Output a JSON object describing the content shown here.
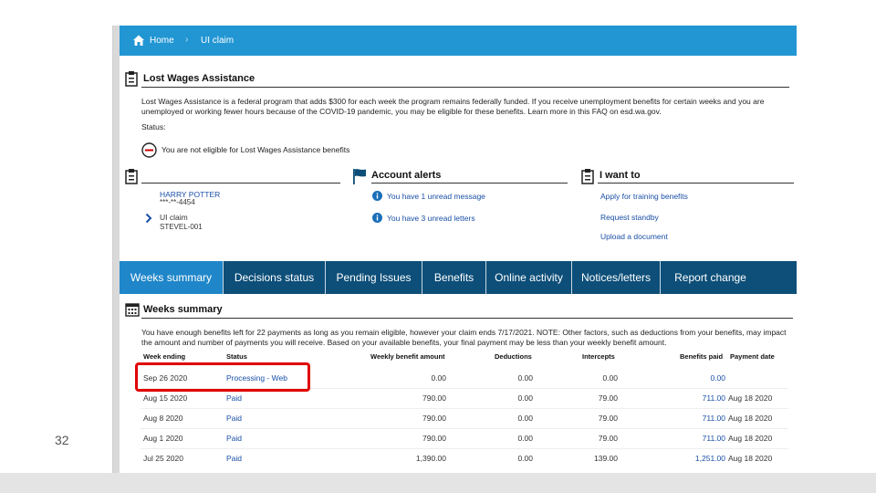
{
  "slide": {
    "number": "32"
  },
  "breadcrumb": {
    "home": "Home",
    "separator": "›",
    "current": "UI claim"
  },
  "lwa": {
    "title": "Lost Wages Assistance",
    "description": "Lost Wages Assistance is a federal program that adds $300 for each week the program remains federally funded. If you receive unemployment benefits for certain weeks and you are unemployed or working fewer hours because of the COVID-19 pandemic, you may be eligible for these benefits. Learn more in this FAQ on esd.wa.gov.",
    "status_label": "Status:",
    "status_text": "You are not eligible for Lost Wages Assistance benefits"
  },
  "profile": {
    "name": "HARRY POTTER",
    "ssn": "***-**-4454",
    "claim_label": "UI claim",
    "claim_id": "STEVEL-001"
  },
  "account_alerts": {
    "title": "Account alerts",
    "items": [
      "You have 1 unread message",
      "You have 3 unread letters"
    ]
  },
  "i_want_to": {
    "title": "I want to",
    "items": [
      "Apply for training benefits",
      "Request standby",
      "Upload a document"
    ]
  },
  "tabs": [
    "Weeks summary",
    "Decisions status",
    "Pending Issues",
    "Benefits",
    "Online activity",
    "Notices/letters",
    "Report change"
  ],
  "weeks_summary": {
    "title": "Weeks summary",
    "note": "You have enough benefits left for 22 payments as long as you remain eligible, however your claim ends 7/17/2021. NOTE: Other factors, such as deductions from your benefits, may impact the amount and number of payments you will receive. Based on your available benefits, your final payment may be less than your weekly benefit amount.",
    "columns": [
      "Week ending",
      "Status",
      "Weekly benefit amount",
      "Deductions",
      "Intercepts",
      "Benefits paid",
      "Payment date"
    ],
    "rows": [
      [
        "Sep 26 2020",
        "Processing - Web",
        "0.00",
        "0.00",
        "0.00",
        "0.00",
        ""
      ],
      [
        "Aug 15 2020",
        "Paid",
        "790.00",
        "0.00",
        "79.00",
        "711.00",
        "Aug 18 2020"
      ],
      [
        "Aug 8 2020",
        "Paid",
        "790.00",
        "0.00",
        "79.00",
        "711.00",
        "Aug 18 2020"
      ],
      [
        "Aug 1 2020",
        "Paid",
        "790.00",
        "0.00",
        "79.00",
        "711.00",
        "Aug 18 2020"
      ],
      [
        "Jul 25 2020",
        "Paid",
        "1,390.00",
        "0.00",
        "139.00",
        "1,251.00",
        "Aug 18 2020"
      ]
    ]
  },
  "colors": {
    "header_blue": "#2196d3",
    "tab_navy": "#0d4f79",
    "tab_active": "#1f86c9",
    "link": "#1a4fa6",
    "highlight_red": "#e00000"
  }
}
